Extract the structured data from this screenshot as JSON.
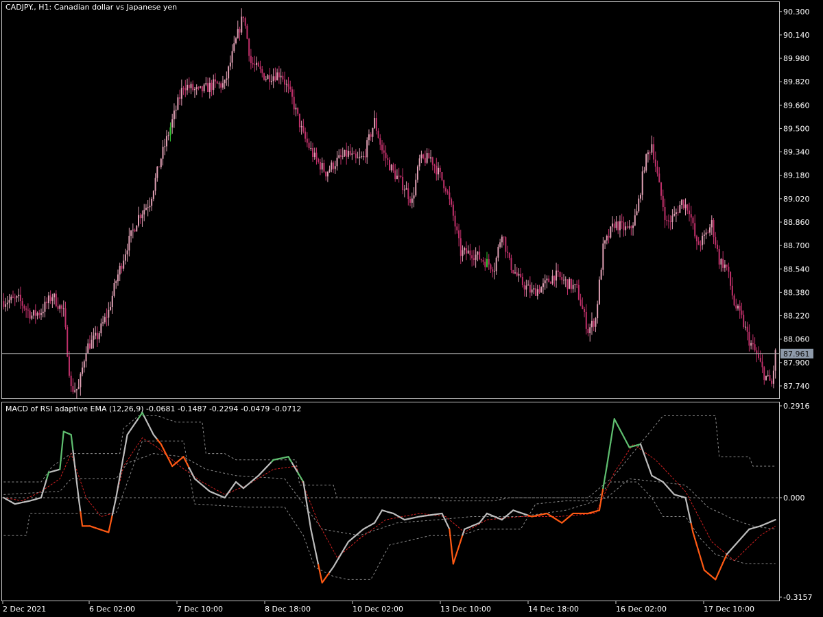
{
  "colors": {
    "background": "#000000",
    "frame": "#c8c8c8",
    "text": "#ffffff",
    "candle": "#e0a0b4",
    "candle_dark": "#c0306a",
    "candle_up_highlight": "#33cc33",
    "macd_neutral": "#bdbdbd",
    "macd_up": "#5fbf70",
    "macd_down": "#ff5a14",
    "signal": "#d02020",
    "bands": "#8c8c8c",
    "price_badge_bg": "#8e9aaa"
  },
  "main_panel": {
    "title": "CADJPY., H1:  Canadian dollar vs Japanese yen",
    "current_price": "87.961",
    "yaxis_ticks": [
      "90.300",
      "90.140",
      "89.980",
      "89.820",
      "89.660",
      "89.500",
      "89.340",
      "89.180",
      "89.020",
      "88.860",
      "88.700",
      "88.540",
      "88.380",
      "88.220",
      "88.060",
      "87.900",
      "87.740"
    ]
  },
  "sub_panel": {
    "title": "MACD of RSI adaptive EMA (12,26,9) -0.0681 -0.1487 -0.2294 -0.0479 -0.0712",
    "yaxis_ticks": [
      "0.2916",
      "0.000",
      "-0.3157"
    ]
  },
  "xaxis_ticks": [
    "2 Dec 2021",
    "6 Dec 02:00",
    "7 Dec 10:00",
    "8 Dec 18:00",
    "10 Dec 02:00",
    "13 Dec 10:00",
    "14 Dec 18:00",
    "16 Dec 02:00",
    "17 Dec 10:00"
  ],
  "chart_data": [
    {
      "type": "candlestick",
      "title": "CADJPY., H1:  Canadian dollar vs Japanese yen",
      "ylim": [
        87.66,
        90.36
      ],
      "last_price": 87.961,
      "close_keypoints": [
        [
          0,
          88.32
        ],
        [
          8,
          88.33
        ],
        [
          15,
          88.22
        ],
        [
          20,
          88.25
        ],
        [
          26,
          88.36
        ],
        [
          32,
          88.24
        ],
        [
          36,
          87.72
        ],
        [
          40,
          87.72
        ],
        [
          44,
          88.0
        ],
        [
          50,
          88.08
        ],
        [
          56,
          88.25
        ],
        [
          60,
          88.46
        ],
        [
          66,
          88.7
        ],
        [
          72,
          88.9
        ],
        [
          78,
          89.0
        ],
        [
          84,
          89.3
        ],
        [
          90,
          89.55
        ],
        [
          96,
          89.8
        ],
        [
          104,
          89.75
        ],
        [
          112,
          89.8
        ],
        [
          118,
          89.8
        ],
        [
          124,
          90.1
        ],
        [
          128,
          90.28
        ],
        [
          132,
          89.95
        ],
        [
          140,
          89.85
        ],
        [
          148,
          89.88
        ],
        [
          154,
          89.7
        ],
        [
          160,
          89.45
        ],
        [
          166,
          89.3
        ],
        [
          172,
          89.2
        ],
        [
          178,
          89.28
        ],
        [
          184,
          89.33
        ],
        [
          188,
          89.28
        ],
        [
          192,
          89.3
        ],
        [
          198,
          89.55
        ],
        [
          202,
          89.35
        ],
        [
          208,
          89.2
        ],
        [
          214,
          89.1
        ],
        [
          218,
          89.0
        ],
        [
          222,
          89.28
        ],
        [
          228,
          89.3
        ],
        [
          236,
          89.1
        ],
        [
          240,
          88.9
        ],
        [
          244,
          88.65
        ],
        [
          250,
          88.65
        ],
        [
          256,
          88.6
        ],
        [
          262,
          88.55
        ],
        [
          266,
          88.8
        ],
        [
          270,
          88.58
        ],
        [
          276,
          88.45
        ],
        [
          282,
          88.38
        ],
        [
          288,
          88.42
        ],
        [
          294,
          88.5
        ],
        [
          300,
          88.45
        ],
        [
          306,
          88.4
        ],
        [
          312,
          88.12
        ],
        [
          316,
          88.2
        ],
        [
          320,
          88.68
        ],
        [
          326,
          88.85
        ],
        [
          334,
          88.8
        ],
        [
          338,
          88.92
        ],
        [
          342,
          89.25
        ],
        [
          346,
          89.4
        ],
        [
          350,
          89.1
        ],
        [
          354,
          88.85
        ],
        [
          358,
          88.9
        ],
        [
          362,
          89.0
        ],
        [
          366,
          88.95
        ],
        [
          370,
          88.7
        ],
        [
          374,
          88.75
        ],
        [
          378,
          88.85
        ],
        [
          382,
          88.6
        ],
        [
          386,
          88.55
        ],
        [
          390,
          88.3
        ],
        [
          394,
          88.2
        ],
        [
          398,
          88.05
        ],
        [
          402,
          87.95
        ],
        [
          406,
          87.82
        ],
        [
          410,
          87.75
        ],
        [
          412,
          87.96
        ]
      ]
    },
    {
      "type": "line",
      "title": "MACD of RSI adaptive EMA (12,26,9) -0.0681 -0.1487 -0.2294 -0.0479 -0.0712",
      "ylim": [
        -0.3157,
        0.2916
      ],
      "series": [
        {
          "key": "macd",
          "keypoints": [
            [
              0,
              0.0
            ],
            [
              6,
              -0.02
            ],
            [
              14,
              -0.01
            ],
            [
              20,
              0.0
            ],
            [
              24,
              0.08
            ],
            [
              30,
              0.09
            ],
            [
              32,
              0.21
            ],
            [
              36,
              0.2
            ],
            [
              40,
              0.0
            ],
            [
              42,
              -0.09
            ],
            [
              46,
              -0.09
            ],
            [
              56,
              -0.11
            ],
            [
              60,
              0.0
            ],
            [
              66,
              0.2
            ],
            [
              74,
              0.27
            ],
            [
              80,
              0.2
            ],
            [
              84,
              0.17
            ],
            [
              90,
              0.1
            ],
            [
              96,
              0.13
            ],
            [
              102,
              0.06
            ],
            [
              110,
              0.02
            ],
            [
              118,
              0.0
            ],
            [
              124,
              0.05
            ],
            [
              128,
              0.03
            ],
            [
              136,
              0.07
            ],
            [
              144,
              0.12
            ],
            [
              152,
              0.13
            ],
            [
              160,
              0.05
            ],
            [
              164,
              -0.1
            ],
            [
              170,
              -0.27
            ],
            [
              176,
              -0.22
            ],
            [
              184,
              -0.14
            ],
            [
              192,
              -0.1
            ],
            [
              198,
              -0.08
            ],
            [
              202,
              -0.04
            ],
            [
              208,
              -0.05
            ],
            [
              214,
              -0.07
            ],
            [
              222,
              -0.06
            ],
            [
              234,
              -0.05
            ],
            [
              238,
              -0.1
            ],
            [
              240,
              -0.21
            ],
            [
              246,
              -0.1
            ],
            [
              254,
              -0.08
            ],
            [
              258,
              -0.05
            ],
            [
              266,
              -0.07
            ],
            [
              272,
              -0.04
            ],
            [
              282,
              -0.06
            ],
            [
              290,
              -0.05
            ],
            [
              298,
              -0.08
            ],
            [
              304,
              -0.05
            ],
            [
              312,
              -0.05
            ],
            [
              318,
              -0.04
            ],
            [
              322,
              0.1
            ],
            [
              326,
              0.25
            ],
            [
              334,
              0.16
            ],
            [
              340,
              0.17
            ],
            [
              346,
              0.07
            ],
            [
              352,
              0.05
            ],
            [
              358,
              0.01
            ],
            [
              364,
              0.0
            ],
            [
              368,
              -0.11
            ],
            [
              374,
              -0.23
            ],
            [
              380,
              -0.26
            ],
            [
              386,
              -0.18
            ],
            [
              392,
              -0.14
            ],
            [
              398,
              -0.1
            ],
            [
              404,
              -0.09
            ],
            [
              408,
              -0.08
            ],
            [
              412,
              -0.07
            ]
          ]
        },
        {
          "key": "signal",
          "keypoints": [
            [
              0,
              0.0
            ],
            [
              10,
              -0.01
            ],
            [
              20,
              0.02
            ],
            [
              30,
              0.06
            ],
            [
              36,
              0.14
            ],
            [
              44,
              0.0
            ],
            [
              52,
              -0.06
            ],
            [
              58,
              -0.05
            ],
            [
              64,
              0.1
            ],
            [
              74,
              0.19
            ],
            [
              82,
              0.16
            ],
            [
              94,
              0.1
            ],
            [
              106,
              0.05
            ],
            [
              118,
              0.01
            ],
            [
              130,
              0.04
            ],
            [
              144,
              0.09
            ],
            [
              156,
              0.1
            ],
            [
              168,
              -0.08
            ],
            [
              178,
              -0.19
            ],
            [
              190,
              -0.13
            ],
            [
              204,
              -0.07
            ],
            [
              222,
              -0.05
            ],
            [
              236,
              -0.06
            ],
            [
              246,
              -0.11
            ],
            [
              258,
              -0.07
            ],
            [
              276,
              -0.06
            ],
            [
              296,
              -0.06
            ],
            [
              316,
              -0.05
            ],
            [
              326,
              0.08
            ],
            [
              336,
              0.17
            ],
            [
              348,
              0.12
            ],
            [
              364,
              0.02
            ],
            [
              378,
              -0.14
            ],
            [
              390,
              -0.2
            ],
            [
              404,
              -0.12
            ],
            [
              412,
              -0.09
            ]
          ]
        },
        {
          "key": "upper_band",
          "keypoints": [
            [
              0,
              0.05
            ],
            [
              20,
              0.05
            ],
            [
              26,
              0.1
            ],
            [
              36,
              0.14
            ],
            [
              62,
              0.14
            ],
            [
              64,
              0.22
            ],
            [
              72,
              0.26
            ],
            [
              82,
              0.26
            ],
            [
              92,
              0.24
            ],
            [
              106,
              0.24
            ],
            [
              108,
              0.14
            ],
            [
              118,
              0.14
            ],
            [
              124,
              0.12
            ],
            [
              156,
              0.12
            ],
            [
              158,
              0.04
            ],
            [
              176,
              0.04
            ],
            [
              178,
              0.0
            ],
            [
              232,
              0.0
            ],
            [
              234,
              -0.01
            ],
            [
              262,
              -0.01
            ],
            [
              270,
              0.0
            ],
            [
              312,
              0.0
            ],
            [
              320,
              0.04
            ],
            [
              326,
              0.07
            ],
            [
              352,
              0.26
            ],
            [
              380,
              0.26
            ],
            [
              382,
              0.13
            ],
            [
              398,
              0.13
            ],
            [
              400,
              0.1
            ],
            [
              412,
              0.1
            ]
          ]
        },
        {
          "key": "lower_band",
          "keypoints": [
            [
              0,
              -0.12
            ],
            [
              12,
              -0.12
            ],
            [
              14,
              -0.05
            ],
            [
              60,
              -0.05
            ],
            [
              74,
              0.18
            ],
            [
              96,
              0.18
            ],
            [
              102,
              -0.02
            ],
            [
              130,
              -0.03
            ],
            [
              150,
              -0.03
            ],
            [
              160,
              -0.12
            ],
            [
              166,
              -0.22
            ],
            [
              176,
              -0.25
            ],
            [
              184,
              -0.26
            ],
            [
              196,
              -0.26
            ],
            [
              206,
              -0.15
            ],
            [
              228,
              -0.12
            ],
            [
              244,
              -0.12
            ],
            [
              254,
              -0.1
            ],
            [
              276,
              -0.1
            ],
            [
              284,
              -0.02
            ],
            [
              300,
              -0.01
            ],
            [
              316,
              -0.01
            ],
            [
              324,
              0.05
            ],
            [
              338,
              0.05
            ],
            [
              346,
              0.0
            ],
            [
              352,
              -0.06
            ],
            [
              364,
              -0.06
            ],
            [
              372,
              -0.13
            ],
            [
              380,
              -0.18
            ],
            [
              396,
              -0.21
            ],
            [
              412,
              -0.21
            ]
          ]
        },
        {
          "key": "mid_band",
          "keypoints": [
            [
              0,
              0.01
            ],
            [
              30,
              0.02
            ],
            [
              36,
              0.06
            ],
            [
              60,
              0.06
            ],
            [
              66,
              0.11
            ],
            [
              80,
              0.14
            ],
            [
              96,
              0.13
            ],
            [
              108,
              0.09
            ],
            [
              124,
              0.07
            ],
            [
              150,
              0.06
            ],
            [
              160,
              -0.02
            ],
            [
              170,
              -0.1
            ],
            [
              190,
              -0.12
            ],
            [
              210,
              -0.08
            ],
            [
              232,
              -0.07
            ],
            [
              250,
              -0.06
            ],
            [
              276,
              -0.06
            ],
            [
              300,
              -0.04
            ],
            [
              322,
              0.0
            ],
            [
              334,
              0.06
            ],
            [
              350,
              0.05
            ],
            [
              364,
              0.04
            ],
            [
              376,
              -0.03
            ],
            [
              390,
              -0.07
            ],
            [
              400,
              -0.09
            ],
            [
              412,
              -0.1
            ]
          ]
        }
      ]
    }
  ]
}
